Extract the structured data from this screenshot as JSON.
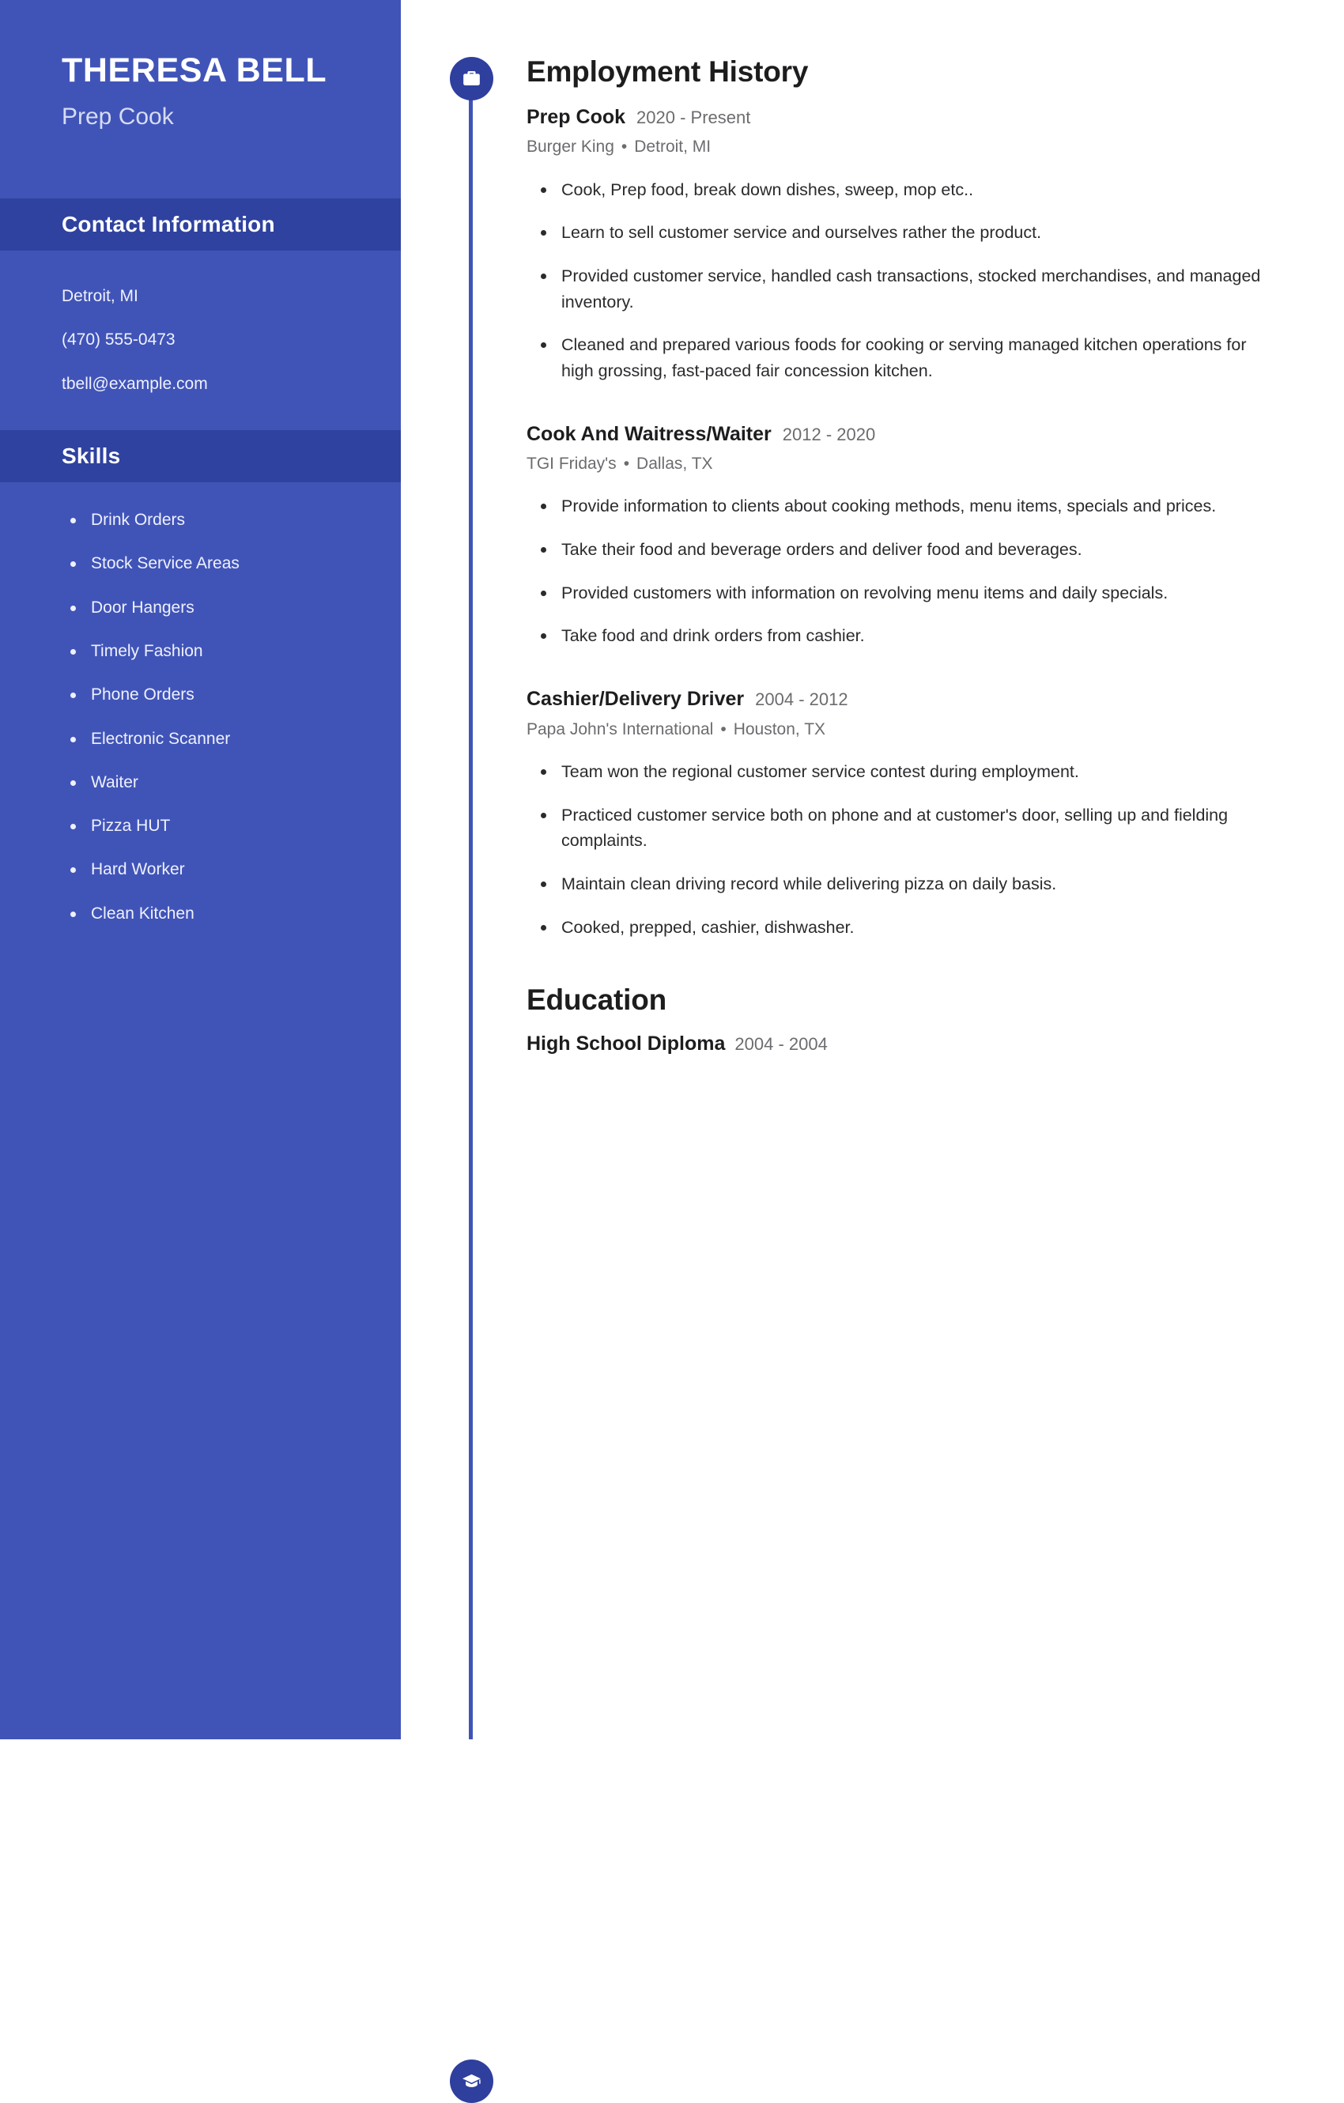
{
  "sidebar": {
    "name": "THERESA BELL",
    "role": "Prep Cook",
    "contact_heading": "Contact Information",
    "contact": [
      "Detroit, MI",
      "(470) 555-0473",
      "tbell@example.com"
    ],
    "skills_heading": "Skills",
    "skills": [
      "Drink Orders",
      "Stock Service Areas",
      "Door Hangers",
      "Timely Fashion",
      "Phone Orders",
      "Electronic Scanner",
      "Waiter",
      "Pizza HUT",
      "Hard Worker",
      "Clean Kitchen"
    ]
  },
  "employment": {
    "heading": "Employment History",
    "icon": "briefcase-icon",
    "jobs": [
      {
        "title": "Prep Cook",
        "dates": "2020 - Present",
        "company": "Burger King",
        "separator": "•",
        "location": "Detroit, MI",
        "duties": [
          "Cook, Prep food, break down dishes, sweep, mop etc..",
          "Learn to sell customer service and ourselves rather the product.",
          "Provided customer service, handled cash transactions, stocked merchandises, and managed inventory.",
          "Cleaned and prepared various foods for cooking or serving managed kitchen operations for high grossing, fast-paced fair concession kitchen."
        ]
      },
      {
        "title": "Cook And Waitress/Waiter",
        "dates": "2012 - 2020",
        "company": "TGI Friday's",
        "separator": "•",
        "location": "Dallas, TX",
        "duties": [
          "Provide information to clients about cooking methods, menu items, specials and prices.",
          "Take their food and beverage orders and deliver food and beverages.",
          "Provided customers with information on revolving menu items and daily specials.",
          "Take food and drink orders from cashier."
        ]
      },
      {
        "title": "Cashier/Delivery Driver",
        "dates": "2004 - 2012",
        "company": "Papa John's International",
        "separator": "•",
        "location": "Houston, TX",
        "duties": [
          "Team won the regional customer service contest during employment.",
          "Practiced customer service both on phone and at customer's door, selling up and fielding complaints.",
          "Maintain clean driving record while delivering pizza on daily basis.",
          "Cooked, prepped, cashier, dishwasher."
        ]
      }
    ]
  },
  "education": {
    "heading": "Education",
    "icon": "graduation-cap-icon",
    "entries": [
      {
        "degree": "High School Diploma",
        "dates": "2004 - 2004"
      }
    ]
  },
  "colors": {
    "sidebar_bg": "#4054b8",
    "sidebar_band_bg": "#2f429f",
    "accent": "#2f3f9e",
    "timeline": "#4054b8",
    "heading_text": "#1d1d1f",
    "muted_text": "#6c6c70",
    "body_text": "#2b2b2e",
    "sidebar_text": "#eff1fb",
    "role_text": "#d6dcf2"
  }
}
